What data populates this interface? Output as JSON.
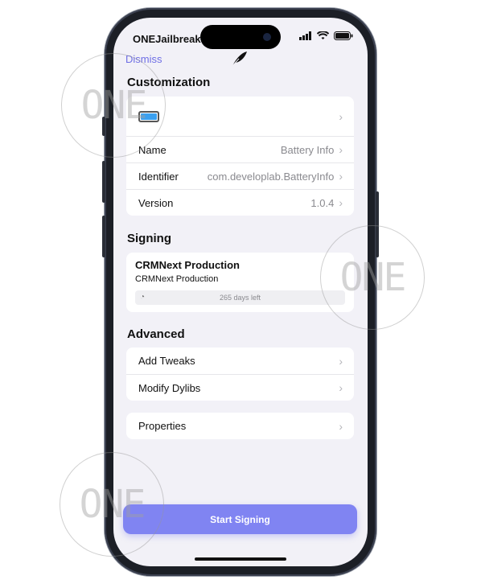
{
  "status_bar": {
    "carrier": "ONEJailbreak"
  },
  "nav": {
    "dismiss_label": "Dismiss"
  },
  "customization": {
    "title": "Customization",
    "rows": [
      {
        "label": "Name",
        "value": "Battery Info"
      },
      {
        "label": "Identifier",
        "value": "com.developlab.BatteryInfo"
      },
      {
        "label": "Version",
        "value": "1.0.4"
      }
    ]
  },
  "signing": {
    "title": "Signing",
    "cert_name": "CRMNext Production",
    "cert_team": "CRMNext Production",
    "days_left": "265 days left"
  },
  "advanced": {
    "title": "Advanced",
    "items": [
      {
        "label": "Add Tweaks"
      },
      {
        "label": "Modify Dylibs"
      }
    ],
    "properties_label": "Properties"
  },
  "actions": {
    "start_label": "Start Signing"
  },
  "watermark": {
    "text": "ONE"
  },
  "colors": {
    "accent": "#8084f2",
    "dismiss": "#6e6ee5",
    "background": "#f2f1f7"
  }
}
